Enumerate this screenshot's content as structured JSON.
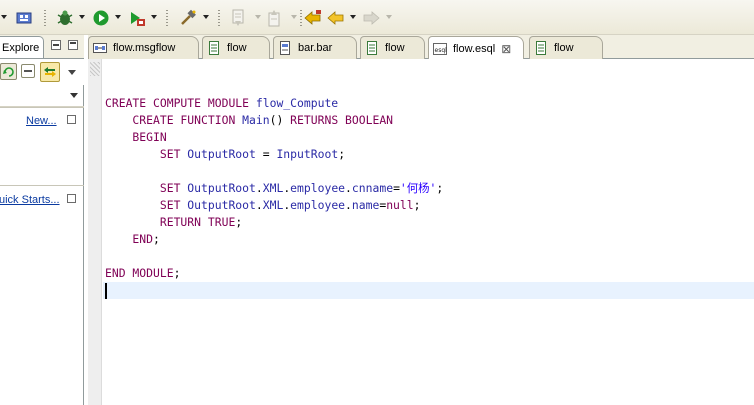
{
  "toolbar": {
    "icons": [
      "grid-icon",
      "debug-icon",
      "run-icon",
      "external-tools-icon",
      "hammer-icon",
      "next-annotation-icon",
      "prev-annotation-icon",
      "last-edit-icon",
      "back-icon",
      "forward-icon"
    ],
    "colors": {
      "run": "#1f9a2e",
      "back": "#e8b400",
      "bug": "#2f6e2f"
    }
  },
  "left_panel": {
    "tab_label": "Explore",
    "new_link": "New...",
    "quick_starts_link": "uick Starts..."
  },
  "editor_tabs": [
    {
      "label": "flow.msgflow",
      "icon": "msgflow-icon"
    },
    {
      "label": "flow",
      "icon": "file-icon"
    },
    {
      "label": "bar.bar",
      "icon": "bar-file-icon"
    },
    {
      "label": "flow",
      "icon": "file-icon"
    },
    {
      "label": "flow.esql",
      "icon": "esql-icon",
      "active": true
    },
    {
      "label": "flow",
      "icon": "file-icon"
    }
  ],
  "editor": {
    "lines": [
      [
        [
          "kw",
          "CREATE COMPUTE MODULE "
        ],
        [
          "id",
          "flow_Compute"
        ]
      ],
      [
        [
          "kw",
          "    CREATE FUNCTION "
        ],
        [
          "id",
          "Main"
        ],
        [
          "pl",
          "() "
        ],
        [
          "kw",
          "RETURNS BOOLEAN"
        ]
      ],
      [
        [
          "kw",
          "    BEGIN"
        ]
      ],
      [
        [
          "kw",
          "        SET "
        ],
        [
          "id",
          "OutputRoot"
        ],
        [
          "pl",
          " = "
        ],
        [
          "id",
          "InputRoot"
        ],
        [
          "pl",
          ";"
        ]
      ],
      [],
      [
        [
          "kw",
          "        SET "
        ],
        [
          "id",
          "OutputRoot"
        ],
        [
          "pl",
          "."
        ],
        [
          "id",
          "XML"
        ],
        [
          "pl",
          "."
        ],
        [
          "id",
          "employee"
        ],
        [
          "pl",
          "."
        ],
        [
          "id",
          "cnname"
        ],
        [
          "pl",
          "="
        ],
        [
          "str",
          "'何杨'"
        ],
        [
          "pl",
          ";"
        ]
      ],
      [
        [
          "kw",
          "        SET "
        ],
        [
          "id",
          "OutputRoot"
        ],
        [
          "pl",
          "."
        ],
        [
          "id",
          "XML"
        ],
        [
          "pl",
          "."
        ],
        [
          "id",
          "employee"
        ],
        [
          "pl",
          "."
        ],
        [
          "id",
          "name"
        ],
        [
          "pl",
          "="
        ],
        [
          "kw",
          "null"
        ],
        [
          "pl",
          ";"
        ]
      ],
      [
        [
          "kw",
          "        RETURN TRUE"
        ],
        [
          "pl",
          ";"
        ]
      ],
      [
        [
          "kw",
          "    END"
        ],
        [
          "pl",
          ";"
        ]
      ],
      [],
      [
        [
          "kw",
          "END MODULE"
        ],
        [
          "pl",
          ";"
        ]
      ]
    ],
    "colors": {
      "keyword": "#7f0055",
      "identifier": "#2b2ba6",
      "string": "#2a00ff",
      "current_line": "#e8f2fe"
    }
  }
}
